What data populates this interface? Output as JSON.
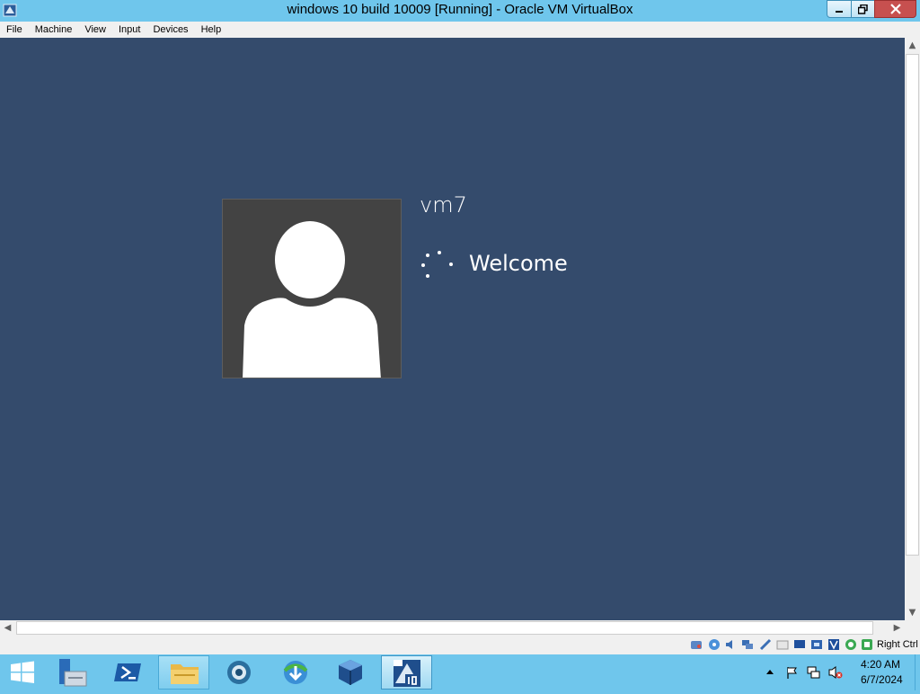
{
  "window": {
    "title": "windows 10 build 10009 [Running] - Oracle VM VirtualBox",
    "app_icon": "virtualbox-icon"
  },
  "menu": {
    "items": [
      {
        "label": "File"
      },
      {
        "label": "Machine"
      },
      {
        "label": "View"
      },
      {
        "label": "Input"
      },
      {
        "label": "Devices"
      },
      {
        "label": "Help"
      }
    ]
  },
  "guest": {
    "background_color": "#344b6c",
    "user_name": "vm7",
    "status": "Welcome",
    "avatar_icon": "user-silhouette-icon"
  },
  "statusbar": {
    "host_key": "Right Ctrl",
    "icons": [
      "hard-disk-icon",
      "optical-drive-icon",
      "audio-icon",
      "network-icon",
      "usb-icon",
      "shared-folders-icon",
      "display-icon",
      "video-capture-icon",
      "virtualization-icon",
      "mouse-integration-icon",
      "keyboard-icon"
    ]
  },
  "taskbar": {
    "start_icon": "windows-start-icon",
    "pinned_apps": [
      "server-manager-icon",
      "powershell-icon",
      "file-explorer-icon",
      "browser-icon",
      "download-manager-icon",
      "virtualbox-icon",
      "vm-windows-10-icon"
    ],
    "tray_icons": [
      "show-hidden-icons-icon",
      "action-center-flag-icon",
      "network-icon",
      "volume-muted-icon"
    ],
    "clock": {
      "time": "4:20 AM",
      "date": "6/7/2024"
    }
  },
  "colors": {
    "accent": "#6fc6ec",
    "guest_bg": "#344b6c",
    "close_button": "#c7504f"
  }
}
